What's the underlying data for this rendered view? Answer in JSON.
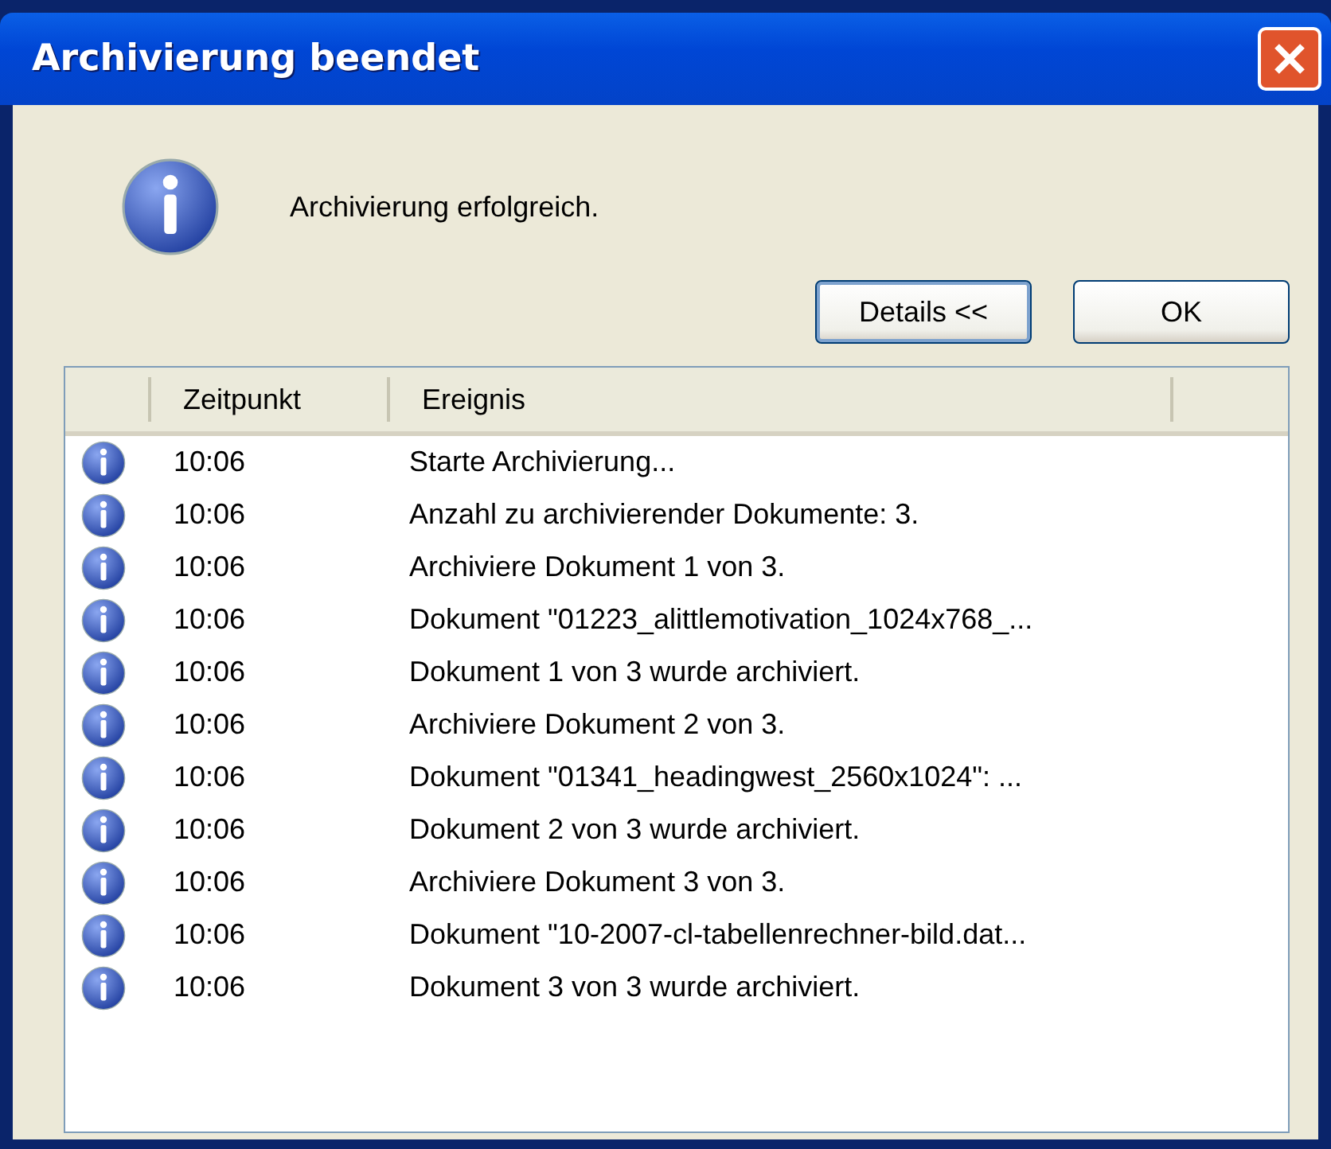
{
  "window": {
    "title": "Archivierung beendet"
  },
  "message": "Archivierung erfolgreich.",
  "buttons": [
    {
      "label": "Details <<",
      "focused": true
    },
    {
      "label": "OK",
      "focused": false
    }
  ],
  "table": {
    "columns": [
      "Zeitpunkt",
      "Ereignis"
    ],
    "rows": [
      {
        "time": "10:06",
        "event": "Starte Archivierung..."
      },
      {
        "time": "10:06",
        "event": "Anzahl zu archivierender Dokumente: 3."
      },
      {
        "time": "10:06",
        "event": "Archiviere Dokument 1 von 3."
      },
      {
        "time": "10:06",
        "event": "Dokument \"01223_alittlemotivation_1024x768_..."
      },
      {
        "time": "10:06",
        "event": "Dokument 1 von 3 wurde archiviert."
      },
      {
        "time": "10:06",
        "event": "Archiviere Dokument 2 von 3."
      },
      {
        "time": "10:06",
        "event": "Dokument \"01341_headingwest_2560x1024\": ..."
      },
      {
        "time": "10:06",
        "event": "Dokument 2 von 3 wurde archiviert."
      },
      {
        "time": "10:06",
        "event": "Archiviere Dokument 3 von 3."
      },
      {
        "time": "10:06",
        "event": "Dokument \"10-2007-cl-tabellenrechner-bild.dat..."
      },
      {
        "time": "10:06",
        "event": "Dokument 3 von 3 wurde archiviert."
      }
    ]
  }
}
